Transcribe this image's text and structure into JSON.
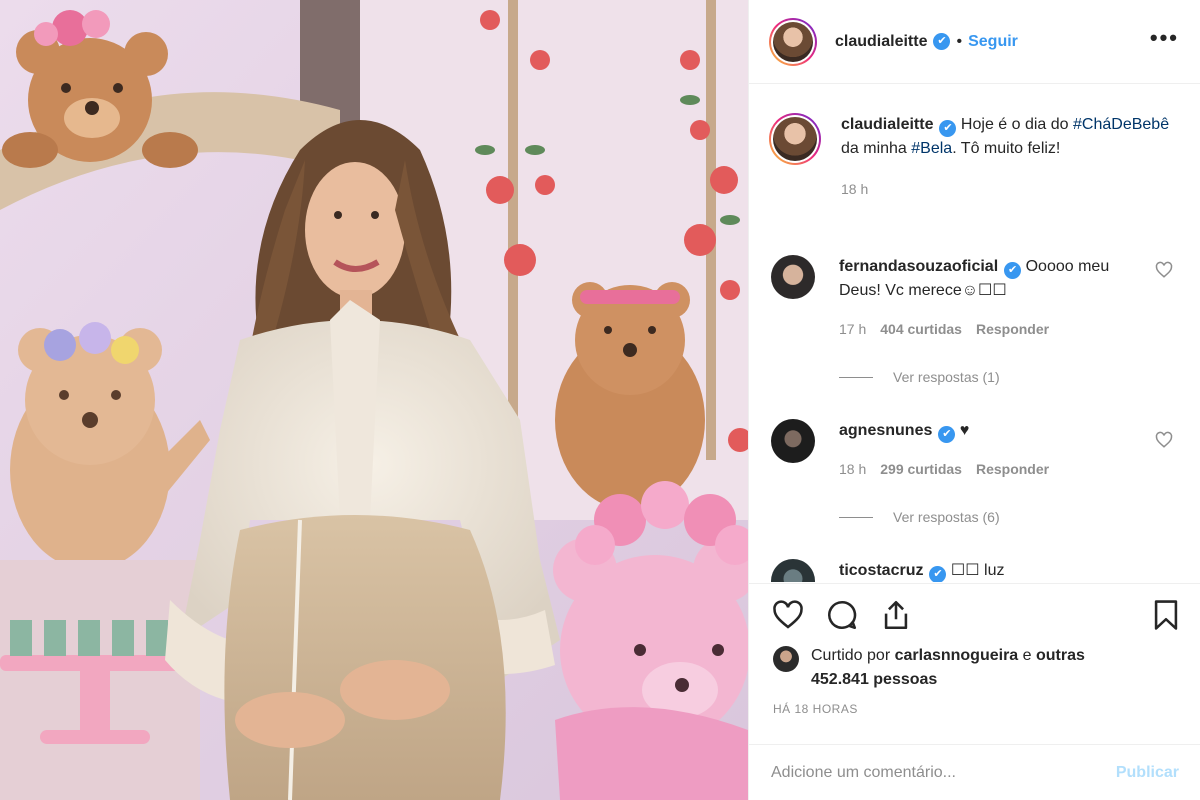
{
  "post": {
    "username": "claudialeitte",
    "verified_mark": "✔",
    "separator": "•",
    "follow_label": "Seguir",
    "more_label": "•••"
  },
  "caption": {
    "username": "claudialeitte",
    "text_1": " Hoje é o dia do ",
    "hashtag_1": "#CháDeBebê",
    "text_2": " da minha ",
    "hashtag_2": "#Bela",
    "text_3": ". Tô muito feliz!",
    "time": "18 h"
  },
  "comments": [
    {
      "username": "fernandasouzaoficial",
      "text": " Ooooo meu Deus! Vc merece☺︎☐☐",
      "time": "17 h",
      "likes": "404 curtidas",
      "reply": "Responder",
      "view_replies": "Ver respostas (1)"
    },
    {
      "username": "agnesnunes",
      "text": " ♥",
      "time": "18 h",
      "likes": "299 curtidas",
      "reply": "Responder",
      "view_replies": "Ver respostas (6)"
    },
    {
      "username": "ticostacruz",
      "text": " ☐☐ luz"
    }
  ],
  "actions": {
    "like_icon": "heart-icon",
    "comment_icon": "comment-icon",
    "share_icon": "share-icon",
    "save_icon": "bookmark-icon"
  },
  "likes": {
    "prefix": "Curtido por ",
    "user": "carlasnnogueira",
    "middle": " e ",
    "others": "outras 452.841 pessoas"
  },
  "timestamp": "HÁ 18 HORAS",
  "add_comment": {
    "placeholder": "Adicione um comentário...",
    "publish_label": "Publicar"
  },
  "colors": {
    "link_blue": "#3897f0",
    "hashtag": "#003569",
    "muted": "#8e8e8e",
    "publish_disabled": "#b2dffc"
  }
}
